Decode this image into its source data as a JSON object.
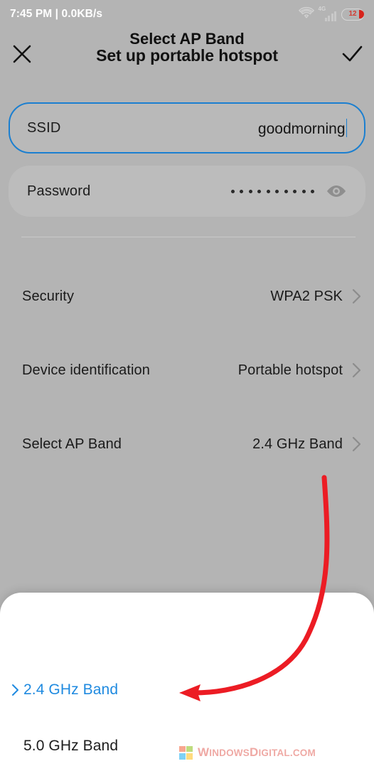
{
  "statusbar": {
    "time_and_rate": "7:45 PM | 0.0KB/s",
    "wifi_icon": "wifi-icon",
    "network_type": "4G",
    "signal_icon": "signal-bars-icon",
    "battery_level": "12",
    "battery_icon": "battery-icon"
  },
  "appbar": {
    "close_icon": "close-x-icon",
    "title": "Set up portable hotspot",
    "confirm_icon": "check-icon"
  },
  "form": {
    "ssid": {
      "label": "SSID",
      "value": "goodmorning",
      "focused": true
    },
    "password": {
      "label": "Password",
      "masked_value": "••••••••••",
      "dot_count": 10,
      "reveal_icon": "eye-icon"
    }
  },
  "settings_rows": [
    {
      "label": "Security",
      "value": "WPA2 PSK",
      "chevron_icon": "chevron-right-icon"
    },
    {
      "label": "Device identification",
      "value": "Portable hotspot",
      "chevron_icon": "chevron-right-icon"
    },
    {
      "label": "Select AP Band",
      "value": "2.4 GHz Band",
      "chevron_icon": "chevron-right-icon"
    }
  ],
  "sheet": {
    "title": "Select AP Band",
    "options": [
      {
        "label": "2.4 GHz Band",
        "selected": true,
        "marker_icon": "chevron-right-icon"
      },
      {
        "label": "5.0 GHz Band",
        "selected": false,
        "marker_icon": ""
      }
    ]
  },
  "annotation": {
    "arrow_icon": "curved-arrow-annotation",
    "color": "#ec1c24"
  },
  "watermark": {
    "logo_icon": "windows-logo-icon",
    "text_primary": "W",
    "text_rest_1": "INDOWS",
    "text_primary_2": "D",
    "text_rest_2": "IGITAL.COM"
  },
  "colors": {
    "page_background": "#b4b4b4",
    "accent_blue": "#1f8ae0",
    "focus_border": "#1b7fd0",
    "sheet_background": "#ffffff",
    "battery_red": "#d6241c",
    "annotation_red": "#ec1c24"
  }
}
